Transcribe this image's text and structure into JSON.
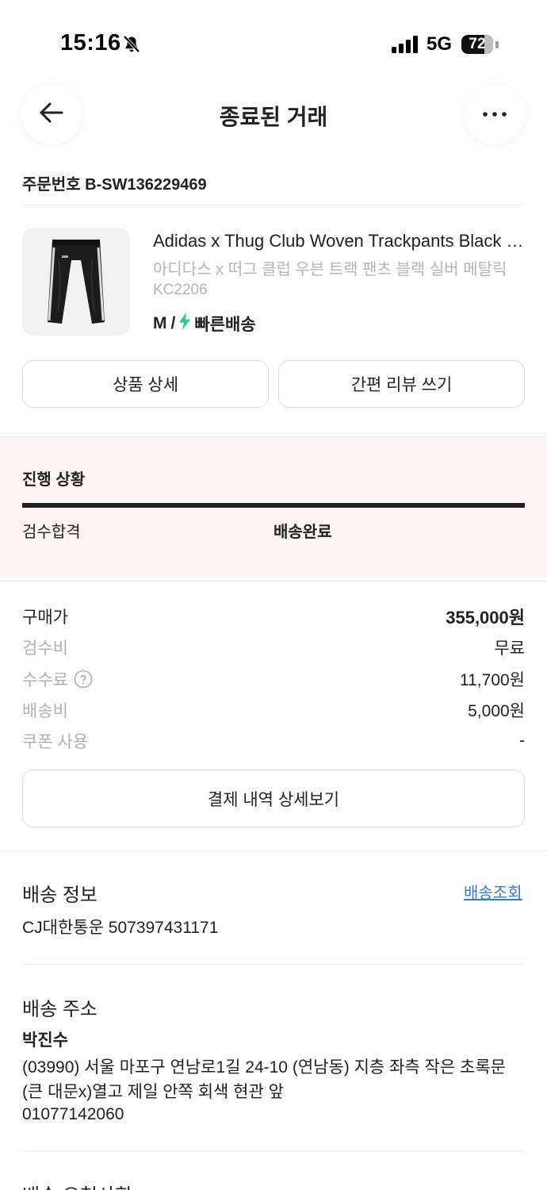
{
  "status_bar": {
    "time": "15:16",
    "network": "5G",
    "battery": "72"
  },
  "header": {
    "title": "종료된 거래",
    "back_icon": "arrow-left-icon",
    "more_icon": "more-horizontal-icon"
  },
  "order": {
    "label": "주문번호",
    "number": "B-SW136229469"
  },
  "product": {
    "name_en": "Adidas x Thug Club Woven Trackpants Black Silver",
    "name_ko": "아디다스 x 떠그 클럽 우븐 트랙 팬츠 블랙 실버 메탈릭",
    "code": "KC2206",
    "size": "M",
    "separator": "/",
    "delivery": "빠른배송",
    "delivery_icon": "lightning-icon",
    "delivery_icon_color": "#2fc88a"
  },
  "actions": {
    "detail_label": "상품 상세",
    "review_label": "간편 리뷰 쓰기"
  },
  "progress": {
    "title": "진행 상황",
    "step_done": "검수합격",
    "step_current": "배송완료",
    "fill": 1.0
  },
  "prices": [
    {
      "label": "구매가",
      "value": "355,000원",
      "emphasis": true
    },
    {
      "label": "검수비",
      "value": "무료",
      "emphasis": false
    },
    {
      "label": "수수료",
      "value": "11,700원",
      "emphasis": false,
      "help": true
    },
    {
      "label": "배송비",
      "value": "5,000원",
      "emphasis": false
    },
    {
      "label": "쿠폰 사용",
      "value": "-",
      "emphasis": false
    }
  ],
  "payment_detail_button": "결제 내역 상세보기",
  "shipping": {
    "title": "배송 정보",
    "track_link": "배송조회",
    "carrier_tracking": "CJ대한통운 507397431171"
  },
  "address": {
    "title": "배송 주소",
    "name": "박진수",
    "line": "(03990) 서울 마포구 연남로1길 24-10 (연남동) 지층 좌측 작은 초록문(큰 대문x)열고 제일 안쪽 회색 현관 앞",
    "phone": "01077142060"
  },
  "next_section_title": "배송 요청사항"
}
